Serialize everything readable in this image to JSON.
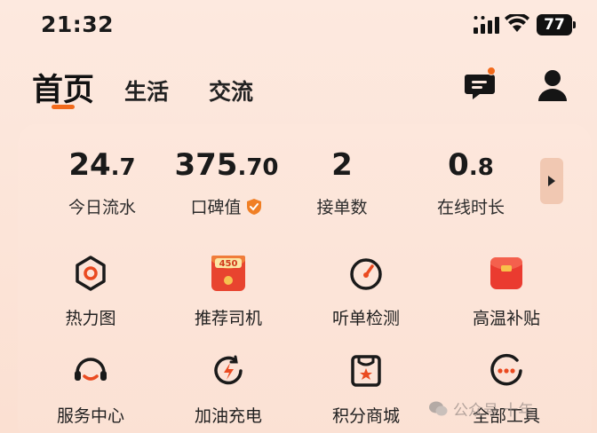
{
  "status_bar": {
    "time": "21:32",
    "battery": "77"
  },
  "header": {
    "tabs": [
      {
        "label": "首页",
        "active": true
      },
      {
        "label": "生活",
        "active": false
      },
      {
        "label": "交流",
        "active": false
      }
    ],
    "accent_color": "#f26a1b"
  },
  "stats": [
    {
      "value_main": "24",
      "value_small": ".7",
      "label": "今日流水"
    },
    {
      "value_main": "375",
      "value_small": ".70",
      "label": "口碑值"
    },
    {
      "value_main": "2",
      "value_small": "",
      "label": "接单数"
    },
    {
      "value_main": "0",
      "value_small": ".8",
      "label": "在线时长"
    }
  ],
  "tools": [
    {
      "label": "热力图",
      "icon": "hexagon-target-icon"
    },
    {
      "label": "推荐司机",
      "icon": "red-envelope-450-icon",
      "icon_text": "450"
    },
    {
      "label": "听单检测",
      "icon": "gauge-icon"
    },
    {
      "label": "高温补贴",
      "icon": "red-packet-icon"
    },
    {
      "label": "服务中心",
      "icon": "headset-icon"
    },
    {
      "label": "加油充电",
      "icon": "charge-icon"
    },
    {
      "label": "积分商城",
      "icon": "points-store-icon"
    },
    {
      "label": "全部工具",
      "icon": "more-tools-icon"
    }
  ],
  "watermark": {
    "text": "公众号 十年"
  }
}
